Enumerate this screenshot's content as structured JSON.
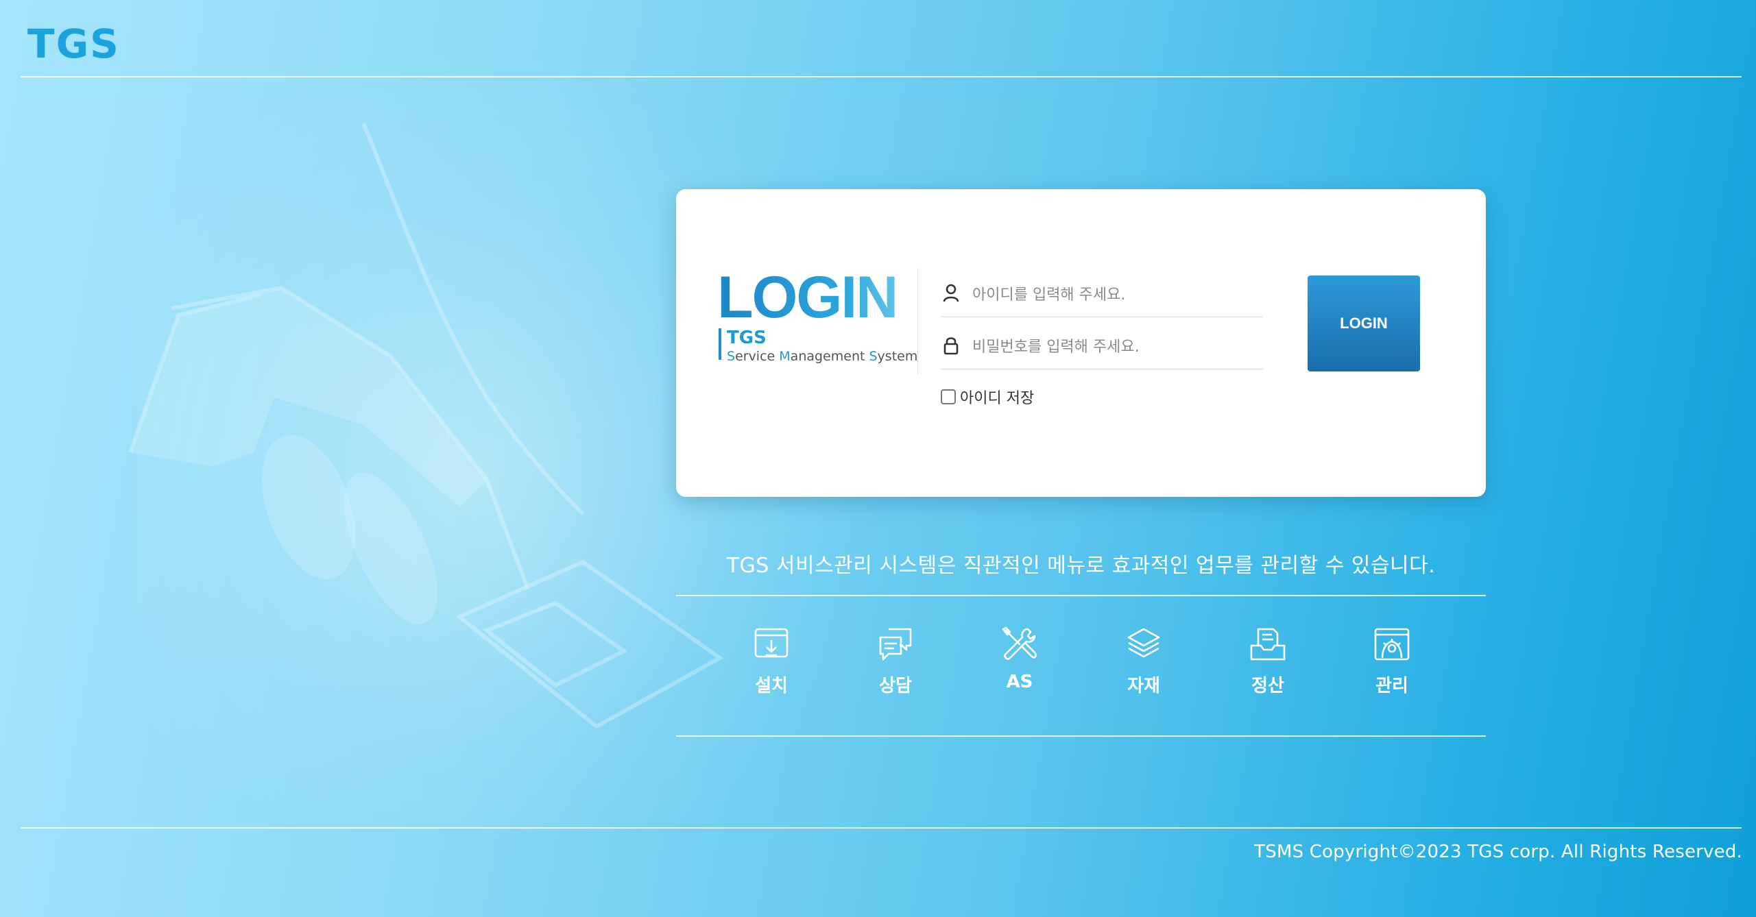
{
  "header": {
    "logo": "TGS"
  },
  "login": {
    "brand_title": "LOGIN",
    "brand_sub": "TGS",
    "brand_system": {
      "s1": "S",
      "w1": "ervice ",
      "s2": "M",
      "w2": "anagement ",
      "s3": "S",
      "w3": "ystem"
    },
    "id_placeholder": "아이디를 입력해 주세요.",
    "pw_placeholder": "비밀번호를 입력해 주세요.",
    "remember_label": "아이디 저장",
    "button_label": "LOGIN"
  },
  "tagline": "TGS 서비스관리 시스템은 직관적인 메뉴로 효과적인 업무를 관리할 수 있습니다.",
  "menu": [
    {
      "label": "설치",
      "icon": "install-icon"
    },
    {
      "label": "상담",
      "icon": "chat-icon"
    },
    {
      "label": "AS",
      "icon": "tools-icon"
    },
    {
      "label": "자재",
      "icon": "layers-icon"
    },
    {
      "label": "정산",
      "icon": "inbox-document-icon"
    },
    {
      "label": "관리",
      "icon": "settings-window-icon"
    }
  ],
  "footer": {
    "copyright": "TSMS Copyright©2023 TGS corp. All Rights Reserved."
  },
  "colors": {
    "accent": "#1aa3dc",
    "button_top": "#2e9ad9",
    "button_bottom": "#1a6eab"
  }
}
